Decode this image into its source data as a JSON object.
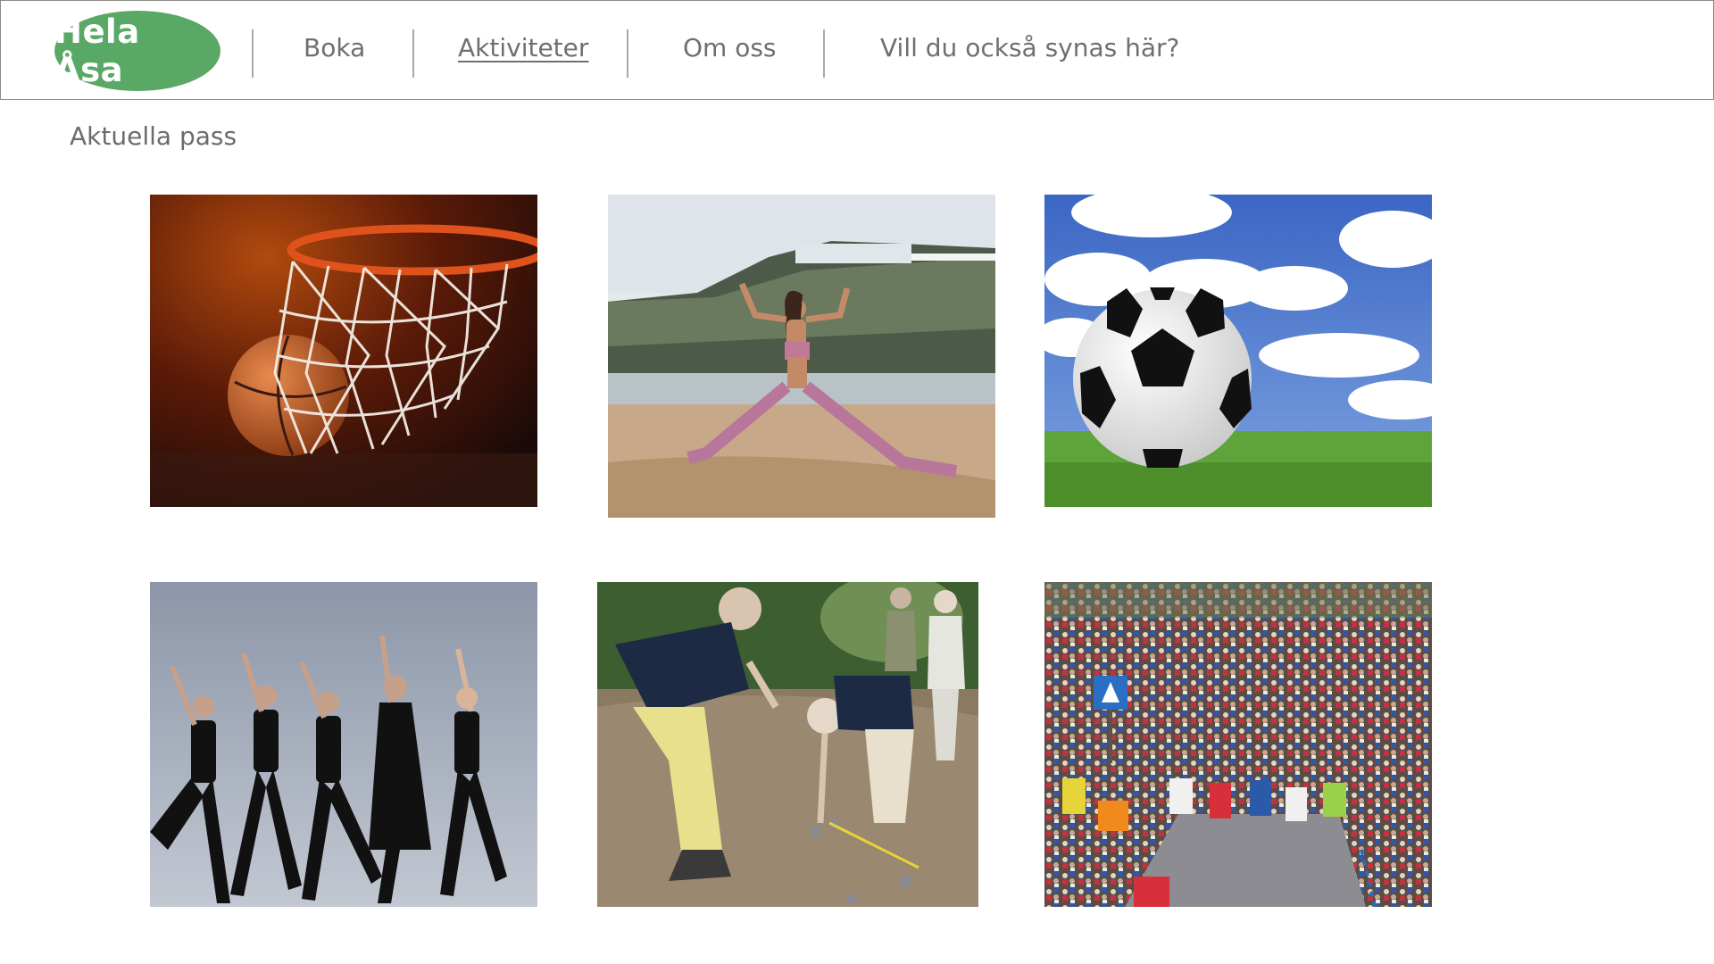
{
  "header": {
    "logo_text": "Hela Åsa",
    "nav": [
      {
        "label": "Boka",
        "active": false
      },
      {
        "label": "Aktiviteter",
        "active": true
      },
      {
        "label": "Om oss",
        "active": false
      },
      {
        "label": "Vill du också synas här?",
        "active": false
      }
    ]
  },
  "main": {
    "section_title": "Aktuella pass",
    "activities": [
      {
        "image": "basketball-hoop-photo"
      },
      {
        "image": "beach-yoga-photo"
      },
      {
        "image": "soccer-ball-photo"
      },
      {
        "image": "dance-group-photo"
      },
      {
        "image": "boules-players-photo"
      },
      {
        "image": "marathon-runners-photo"
      }
    ]
  },
  "colors": {
    "logo_bg": "#5aa866",
    "logo_text": "#ffffff",
    "nav_text": "#6f6f6f",
    "border": "#8a8a8a"
  }
}
